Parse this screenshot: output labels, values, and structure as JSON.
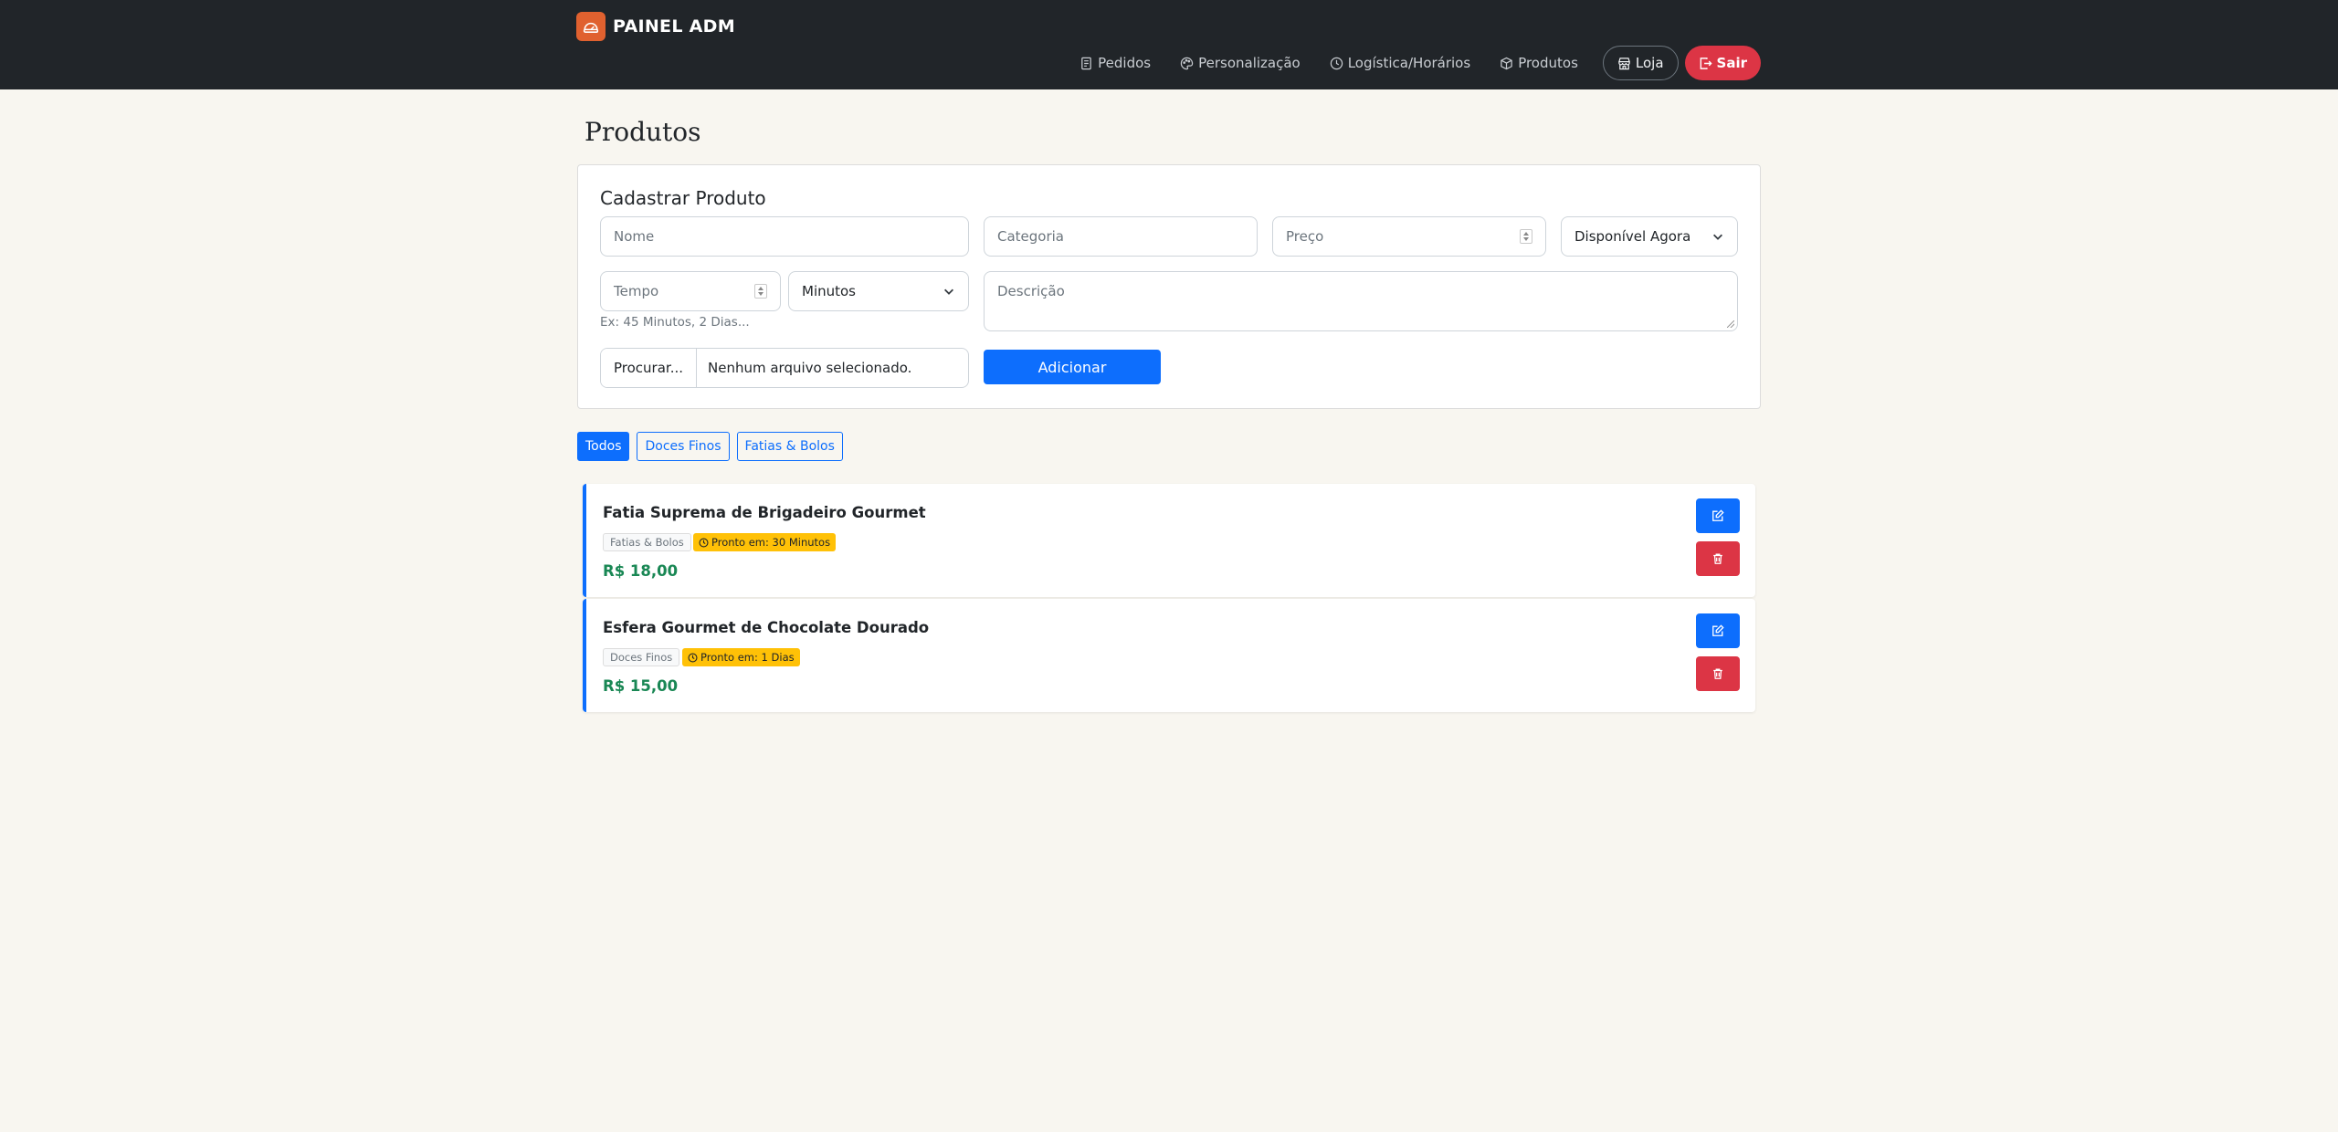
{
  "brand": {
    "title": "PAINEL ADM"
  },
  "nav": {
    "items": [
      {
        "label": "Pedidos",
        "icon": "receipt-icon"
      },
      {
        "label": "Personalização",
        "icon": "palette-icon"
      },
      {
        "label": "Logística/Horários",
        "icon": "clock-icon"
      },
      {
        "label": "Produtos",
        "icon": "box-icon"
      }
    ],
    "store_label": "Loja",
    "logout_label": "Sair"
  },
  "page": {
    "title": "Produtos"
  },
  "form": {
    "title": "Cadastrar Produto",
    "name_placeholder": "Nome",
    "category_placeholder": "Categoria",
    "price_placeholder": "Preço",
    "availability_value": "Disponível Agora",
    "time_placeholder": "Tempo",
    "time_unit_value": "Minutos",
    "description_placeholder": "Descrição",
    "time_help": "Ex: 45 Minutos, 2 Dias...",
    "file_button_label": "Procurar...",
    "file_status": "Nenhum arquivo selecionado.",
    "submit_label": "Adicionar"
  },
  "filters": [
    {
      "label": "Todos",
      "active": true
    },
    {
      "label": "Doces Finos",
      "active": false
    },
    {
      "label": "Fatias & Bolos",
      "active": false
    }
  ],
  "products": [
    {
      "name": "Fatia Suprema de Brigadeiro Gourmet",
      "category": "Fatias & Bolos",
      "ready": "Pronto em: 30 Minutos",
      "price": "R$ 18,00"
    },
    {
      "name": "Esfera Gourmet de Chocolate Dourado",
      "category": "Doces Finos",
      "ready": "Pronto em: 1 Dias",
      "price": "R$ 15,00"
    }
  ],
  "colors": {
    "primary": "#0d6efd",
    "danger": "#dc3545",
    "success": "#198754",
    "warning": "#ffc107",
    "navbar": "#212529",
    "brand": "#e0612f",
    "background": "#f8f6f0"
  }
}
